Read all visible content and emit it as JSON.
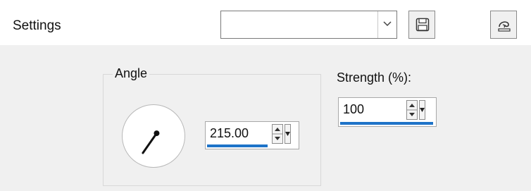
{
  "header": {
    "settings_label": "Settings",
    "preset_value": ""
  },
  "angle": {
    "group_title": "Angle",
    "value": "215.00",
    "degrees": 215
  },
  "strength": {
    "label": "Strength (%):",
    "value": "100"
  },
  "colors": {
    "panel_bg": "#f0f0f0",
    "accent_underline": "#1e73c8"
  },
  "icons": {
    "dropdown": "chevron-down-icon",
    "save": "save-icon",
    "reset": "reset-icon",
    "spin": "spin-arrows-icon",
    "flyout": "flyout-arrow-icon"
  }
}
